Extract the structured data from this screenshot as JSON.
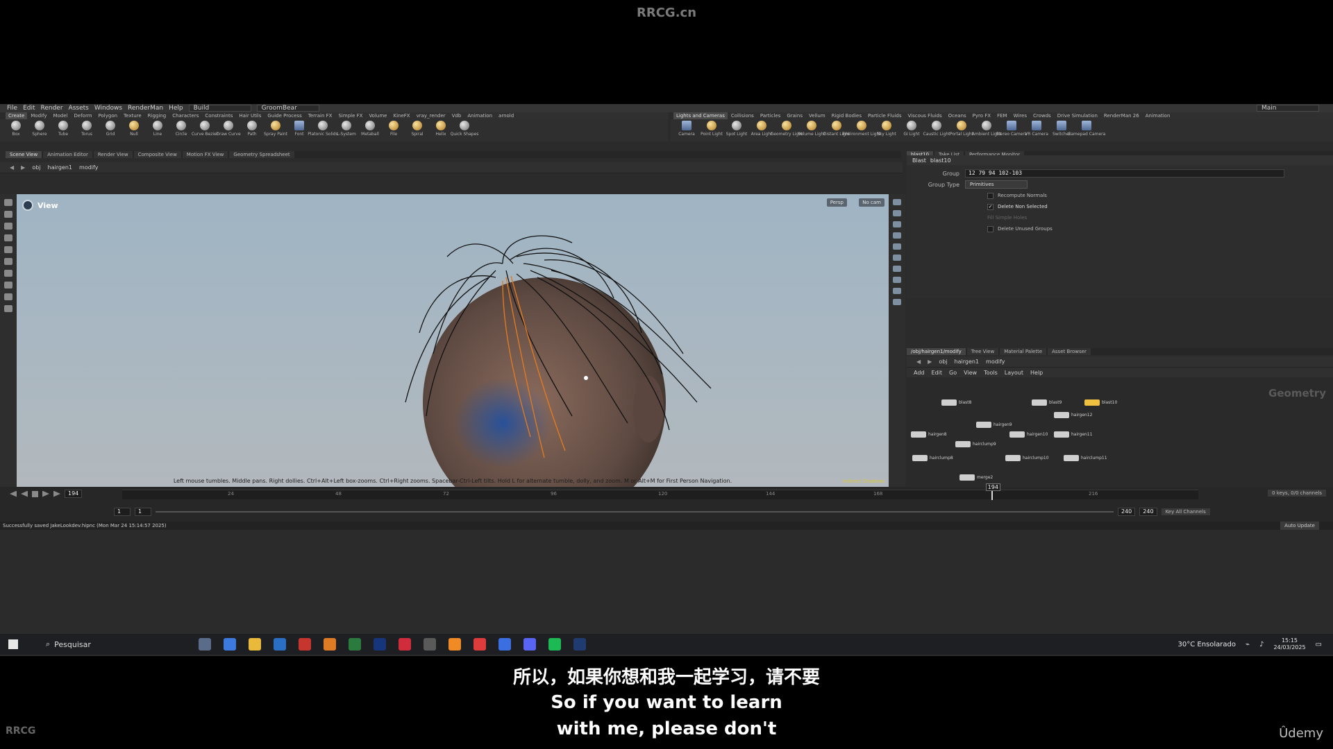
{
  "site_title": "RRCG.cn",
  "menu": {
    "items": [
      "File",
      "Edit",
      "Render",
      "Assets",
      "Windows",
      "RenderMan",
      "Help"
    ],
    "desktop": "Build",
    "context": "GroomBear",
    "main_desktop": "Main"
  },
  "shelf_left": {
    "tabs": [
      "Create",
      "Modify",
      "Model",
      "Deform",
      "Polygon",
      "Texture",
      "Rigging",
      "Characters",
      "Constraints",
      "Hair Utils",
      "Guide Process",
      "Terrain FX",
      "Simple FX",
      "Volume",
      "KineFX",
      "vray_render",
      "Vdb",
      "Animation",
      "arnold"
    ],
    "tools": [
      "Box",
      "Sphere",
      "Tube",
      "Torus",
      "Grid",
      "Null",
      "Line",
      "Circle",
      "Curve Bezier",
      "Draw Curve",
      "Path",
      "Spray Paint",
      "Font",
      "Platonic Solids",
      "L-System",
      "Metaball",
      "File",
      "Spiral",
      "Helix",
      "Quick Shapes"
    ]
  },
  "shelf_right": {
    "tabs": [
      "Lights and Cameras",
      "Collisions",
      "Particles",
      "Grains",
      "Vellum",
      "Rigid Bodies",
      "Particle Fluids",
      "Viscous Fluids",
      "Oceans",
      "Pyro FX",
      "FEM",
      "Wires",
      "Crowds",
      "Drive Simulation",
      "RenderMan 26",
      "Animation"
    ],
    "tools": [
      "Camera",
      "Point Light",
      "Spot Light",
      "Area Light",
      "Geometry Light",
      "Volume Light",
      "Distant Light",
      "Environment Light",
      "Sky Light",
      "GI Light",
      "Caustic Light",
      "Portal Light",
      "Ambient Light",
      "Stereo Camera",
      "VR Camera",
      "Switcher",
      "Gamepad Camera"
    ]
  },
  "viewer_tabs": [
    "Scene View",
    "Animation Editor",
    "Render View",
    "Composite View",
    "Motion FX View",
    "Geometry Spreadsheet"
  ],
  "viewer_path": {
    "root": "obj",
    "node": "hairgen1",
    "leaf": "modify"
  },
  "viewport": {
    "title": "View",
    "persp": "Persp",
    "cam": "No cam",
    "hint": "Left mouse tumbles. Middle pans. Right dollies. Ctrl+Alt+Left box-zooms. Ctrl+Right zooms. Spacebar-Ctrl-Left tilts. Hold L for alternate tumble, dolly, and zoom. M or Alt+M for First Person Navigation.",
    "corner": "Indirect Shadows"
  },
  "params_tabs": [
    "blast10",
    "Take List",
    "Performance Monitor"
  ],
  "params_path": {
    "root": "obj",
    "node": "hairgen1",
    "leaf": "modify"
  },
  "params": {
    "node_type": "Blast",
    "node_name": "blast10",
    "group_label": "Group",
    "group_value": "12 79 94 102-103",
    "group_type_label": "Group Type",
    "group_type_value": "Primitives",
    "checks": [
      {
        "label": "Recompute Normals",
        "checked": false
      },
      {
        "label": "Delete Non Selected",
        "checked": true
      },
      {
        "label": "Fill Simple Holes",
        "checked": false
      },
      {
        "label": "Delete Unused Groups",
        "checked": false
      }
    ]
  },
  "network_tabs": [
    "/obj/hairgen1/modify",
    "Tree View",
    "Material Palette",
    "Asset Browser"
  ],
  "network_path": {
    "root": "obj",
    "node": "hairgen1",
    "leaf": "modify"
  },
  "network_menu": [
    "Add",
    "Edit",
    "Go",
    "View",
    "Tools",
    "Layout",
    "Help"
  ],
  "network": {
    "context": "Geometry",
    "nodes": [
      "blast8",
      "blast9",
      "blast10",
      "hairgen8",
      "hairgen9",
      "hairgen10",
      "hairgen11",
      "hairgen12",
      "hairclump8",
      "hairclump9",
      "hairclump10",
      "hairclump11",
      "merge2"
    ]
  },
  "timeline": {
    "current_frame": "194",
    "start": "1",
    "start2": "1",
    "end": "240",
    "end2": "240",
    "ticks": [
      "24",
      "48",
      "72",
      "96",
      "120",
      "144",
      "168",
      "216"
    ],
    "keys": "0 keys, 0/0 channels",
    "key_mode": "Key All Channels",
    "auto_update": "Auto Update"
  },
  "status": "Successfully saved JakeLookdev.hipnc (Mon Mar 24 15:14:57 2025)",
  "taskbar": {
    "search": "Pesquisar",
    "weather": "30°C  Ensolarado",
    "time": "15:15",
    "date": "24/03/2025"
  },
  "subtitles": {
    "cn": "所以，如果你想和我一起学习，请不要",
    "en1": "So if you want to learn",
    "en2": "with me, please don't"
  },
  "watermark": "RRCG",
  "udemy": "Ûdemy"
}
